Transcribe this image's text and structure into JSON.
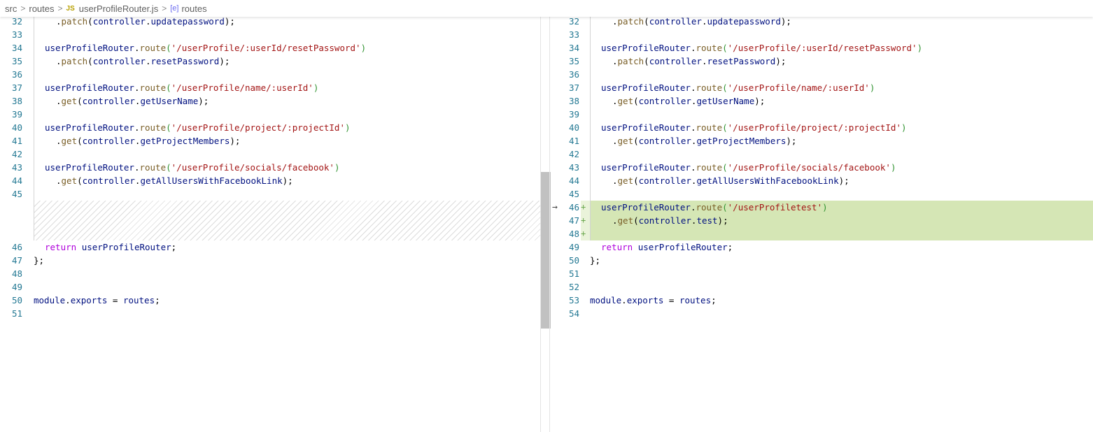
{
  "breadcrumb": {
    "segments": [
      "src",
      "routes",
      "userProfileRouter.js",
      "routes"
    ],
    "file_badge": "JS",
    "symbol_icon": "symbol-variable-icon"
  },
  "left": {
    "lines": [
      {
        "n": "32",
        "indent": 2,
        "tokens": [
          [
            "plain",
            "."
          ],
          [
            "call",
            "patch"
          ],
          [
            "plain",
            "("
          ],
          [
            "ident",
            "controller"
          ],
          [
            "plain",
            "."
          ],
          [
            "ident",
            "updatepassword"
          ],
          [
            "plain",
            ");"
          ]
        ]
      },
      {
        "n": "33",
        "indent": 0,
        "tokens": []
      },
      {
        "n": "34",
        "indent": 1,
        "tokens": [
          [
            "ident",
            "userProfileRouter"
          ],
          [
            "plain",
            "."
          ],
          [
            "call",
            "route"
          ],
          [
            "paren",
            "("
          ],
          [
            "str",
            "'/userProfile/:userId/resetPassword'"
          ],
          [
            "paren",
            ")"
          ]
        ]
      },
      {
        "n": "35",
        "indent": 2,
        "tokens": [
          [
            "plain",
            "."
          ],
          [
            "call",
            "patch"
          ],
          [
            "plain",
            "("
          ],
          [
            "ident",
            "controller"
          ],
          [
            "plain",
            "."
          ],
          [
            "ident",
            "resetPassword"
          ],
          [
            "plain",
            ");"
          ]
        ]
      },
      {
        "n": "36",
        "indent": 0,
        "tokens": []
      },
      {
        "n": "37",
        "indent": 1,
        "tokens": [
          [
            "ident",
            "userProfileRouter"
          ],
          [
            "plain",
            "."
          ],
          [
            "call",
            "route"
          ],
          [
            "paren",
            "("
          ],
          [
            "str",
            "'/userProfile/name/:userId'"
          ],
          [
            "paren",
            ")"
          ]
        ]
      },
      {
        "n": "38",
        "indent": 2,
        "tokens": [
          [
            "plain",
            "."
          ],
          [
            "call",
            "get"
          ],
          [
            "plain",
            "("
          ],
          [
            "ident",
            "controller"
          ],
          [
            "plain",
            "."
          ],
          [
            "ident",
            "getUserName"
          ],
          [
            "plain",
            ");"
          ]
        ]
      },
      {
        "n": "39",
        "indent": 0,
        "tokens": []
      },
      {
        "n": "40",
        "indent": 1,
        "tokens": [
          [
            "ident",
            "userProfileRouter"
          ],
          [
            "plain",
            "."
          ],
          [
            "call",
            "route"
          ],
          [
            "paren",
            "("
          ],
          [
            "str",
            "'/userProfile/project/:projectId'"
          ],
          [
            "paren",
            ")"
          ]
        ]
      },
      {
        "n": "41",
        "indent": 2,
        "tokens": [
          [
            "plain",
            "."
          ],
          [
            "call",
            "get"
          ],
          [
            "plain",
            "("
          ],
          [
            "ident",
            "controller"
          ],
          [
            "plain",
            "."
          ],
          [
            "ident",
            "getProjectMembers"
          ],
          [
            "plain",
            ");"
          ]
        ]
      },
      {
        "n": "42",
        "indent": 0,
        "tokens": []
      },
      {
        "n": "43",
        "indent": 1,
        "tokens": [
          [
            "ident",
            "userProfileRouter"
          ],
          [
            "plain",
            "."
          ],
          [
            "call",
            "route"
          ],
          [
            "paren",
            "("
          ],
          [
            "str",
            "'/userProfile/socials/facebook'"
          ],
          [
            "paren",
            ")"
          ]
        ]
      },
      {
        "n": "44",
        "indent": 2,
        "tokens": [
          [
            "plain",
            "."
          ],
          [
            "call",
            "get"
          ],
          [
            "plain",
            "("
          ],
          [
            "ident",
            "controller"
          ],
          [
            "plain",
            "."
          ],
          [
            "ident",
            "getAllUsersWithFacebookLink"
          ],
          [
            "plain",
            ");"
          ]
        ]
      },
      {
        "n": "45",
        "indent": 0,
        "tokens": []
      },
      {
        "n": "",
        "indent": 0,
        "tokens": [],
        "gap": true
      },
      {
        "n": "",
        "indent": 0,
        "tokens": [],
        "gap": true
      },
      {
        "n": "",
        "indent": 0,
        "tokens": [],
        "gap": true
      },
      {
        "n": "46",
        "indent": 1,
        "tokens": [
          [
            "kw",
            "return"
          ],
          [
            "plain",
            " "
          ],
          [
            "ident",
            "userProfileRouter"
          ],
          [
            "plain",
            ";"
          ]
        ]
      },
      {
        "n": "47",
        "indent": 0,
        "tokens": [
          [
            "plain",
            "};"
          ]
        ]
      },
      {
        "n": "48",
        "indent": 0,
        "tokens": []
      },
      {
        "n": "49",
        "indent": 0,
        "tokens": []
      },
      {
        "n": "50",
        "indent": 0,
        "tokens": [
          [
            "ident",
            "module"
          ],
          [
            "plain",
            "."
          ],
          [
            "ident",
            "exports"
          ],
          [
            "plain",
            " = "
          ],
          [
            "ident",
            "routes"
          ],
          [
            "plain",
            ";"
          ]
        ]
      },
      {
        "n": "51",
        "indent": 0,
        "tokens": []
      }
    ]
  },
  "right": {
    "lines": [
      {
        "n": "32",
        "indent": 2,
        "tokens": [
          [
            "plain",
            "."
          ],
          [
            "call",
            "patch"
          ],
          [
            "plain",
            "("
          ],
          [
            "ident",
            "controller"
          ],
          [
            "plain",
            "."
          ],
          [
            "ident",
            "updatepassword"
          ],
          [
            "plain",
            ");"
          ]
        ]
      },
      {
        "n": "33",
        "indent": 0,
        "tokens": []
      },
      {
        "n": "34",
        "indent": 1,
        "tokens": [
          [
            "ident",
            "userProfileRouter"
          ],
          [
            "plain",
            "."
          ],
          [
            "call",
            "route"
          ],
          [
            "paren",
            "("
          ],
          [
            "str",
            "'/userProfile/:userId/resetPassword'"
          ],
          [
            "paren",
            ")"
          ]
        ]
      },
      {
        "n": "35",
        "indent": 2,
        "tokens": [
          [
            "plain",
            "."
          ],
          [
            "call",
            "patch"
          ],
          [
            "plain",
            "("
          ],
          [
            "ident",
            "controller"
          ],
          [
            "plain",
            "."
          ],
          [
            "ident",
            "resetPassword"
          ],
          [
            "plain",
            ");"
          ]
        ]
      },
      {
        "n": "36",
        "indent": 0,
        "tokens": []
      },
      {
        "n": "37",
        "indent": 1,
        "tokens": [
          [
            "ident",
            "userProfileRouter"
          ],
          [
            "plain",
            "."
          ],
          [
            "call",
            "route"
          ],
          [
            "paren",
            "("
          ],
          [
            "str",
            "'/userProfile/name/:userId'"
          ],
          [
            "paren",
            ")"
          ]
        ]
      },
      {
        "n": "38",
        "indent": 2,
        "tokens": [
          [
            "plain",
            "."
          ],
          [
            "call",
            "get"
          ],
          [
            "plain",
            "("
          ],
          [
            "ident",
            "controller"
          ],
          [
            "plain",
            "."
          ],
          [
            "ident",
            "getUserName"
          ],
          [
            "plain",
            ");"
          ]
        ]
      },
      {
        "n": "39",
        "indent": 0,
        "tokens": []
      },
      {
        "n": "40",
        "indent": 1,
        "tokens": [
          [
            "ident",
            "userProfileRouter"
          ],
          [
            "plain",
            "."
          ],
          [
            "call",
            "route"
          ],
          [
            "paren",
            "("
          ],
          [
            "str",
            "'/userProfile/project/:projectId'"
          ],
          [
            "paren",
            ")"
          ]
        ]
      },
      {
        "n": "41",
        "indent": 2,
        "tokens": [
          [
            "plain",
            "."
          ],
          [
            "call",
            "get"
          ],
          [
            "plain",
            "("
          ],
          [
            "ident",
            "controller"
          ],
          [
            "plain",
            "."
          ],
          [
            "ident",
            "getProjectMembers"
          ],
          [
            "plain",
            ");"
          ]
        ]
      },
      {
        "n": "42",
        "indent": 0,
        "tokens": []
      },
      {
        "n": "43",
        "indent": 1,
        "tokens": [
          [
            "ident",
            "userProfileRouter"
          ],
          [
            "plain",
            "."
          ],
          [
            "call",
            "route"
          ],
          [
            "paren",
            "("
          ],
          [
            "str",
            "'/userProfile/socials/facebook'"
          ],
          [
            "paren",
            ")"
          ]
        ]
      },
      {
        "n": "44",
        "indent": 2,
        "tokens": [
          [
            "plain",
            "."
          ],
          [
            "call",
            "get"
          ],
          [
            "plain",
            "("
          ],
          [
            "ident",
            "controller"
          ],
          [
            "plain",
            "."
          ],
          [
            "ident",
            "getAllUsersWithFacebookLink"
          ],
          [
            "plain",
            ");"
          ]
        ]
      },
      {
        "n": "45",
        "indent": 0,
        "tokens": []
      },
      {
        "n": "46",
        "indent": 1,
        "added": true,
        "tokens": [
          [
            "ident",
            "userProfileRouter"
          ],
          [
            "plain",
            "."
          ],
          [
            "call",
            "route"
          ],
          [
            "paren",
            "("
          ],
          [
            "str",
            "'/userProfiletest'"
          ],
          [
            "paren",
            ")"
          ]
        ]
      },
      {
        "n": "47",
        "indent": 2,
        "added": true,
        "tokens": [
          [
            "plain",
            "."
          ],
          [
            "call",
            "get"
          ],
          [
            "plain",
            "("
          ],
          [
            "ident",
            "controller"
          ],
          [
            "plain",
            "."
          ],
          [
            "ident",
            "test"
          ],
          [
            "plain",
            ");"
          ]
        ]
      },
      {
        "n": "48",
        "indent": 0,
        "added": true,
        "tokens": []
      },
      {
        "n": "49",
        "indent": 1,
        "tokens": [
          [
            "kw",
            "return"
          ],
          [
            "plain",
            " "
          ],
          [
            "ident",
            "userProfileRouter"
          ],
          [
            "plain",
            ";"
          ]
        ]
      },
      {
        "n": "50",
        "indent": 0,
        "tokens": [
          [
            "plain",
            "};"
          ]
        ]
      },
      {
        "n": "51",
        "indent": 0,
        "tokens": []
      },
      {
        "n": "52",
        "indent": 0,
        "tokens": []
      },
      {
        "n": "53",
        "indent": 0,
        "tokens": [
          [
            "ident",
            "module"
          ],
          [
            "plain",
            "."
          ],
          [
            "ident",
            "exports"
          ],
          [
            "plain",
            " = "
          ],
          [
            "ident",
            "routes"
          ],
          [
            "plain",
            ";"
          ]
        ]
      },
      {
        "n": "54",
        "indent": 0,
        "tokens": []
      }
    ]
  },
  "diff": {
    "arrow_glyph": "→",
    "plus_glyph": "+",
    "added_color": "#d5e6b5"
  }
}
